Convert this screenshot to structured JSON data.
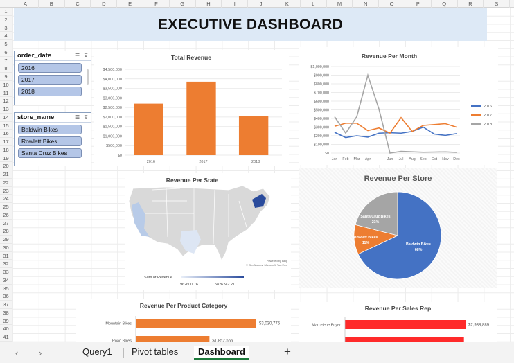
{
  "columns": [
    "A",
    "B",
    "C",
    "D",
    "E",
    "F",
    "G",
    "H",
    "I",
    "J",
    "K",
    "L",
    "M",
    "N",
    "O",
    "P",
    "Q",
    "R",
    "S"
  ],
  "rows": [
    "1",
    "2",
    "3",
    "4",
    "5",
    "6",
    "7",
    "8",
    "9",
    "10",
    "11",
    "12",
    "13",
    "14",
    "15",
    "16",
    "17",
    "18",
    "19",
    "20",
    "21",
    "22",
    "23",
    "24",
    "25",
    "26",
    "27",
    "28",
    "29",
    "30",
    "31",
    "32",
    "33",
    "34",
    "35",
    "36",
    "37",
    "38",
    "39",
    "40",
    "41"
  ],
  "dashboard_title": "EXECUTIVE DASHBOARD",
  "slicer_date": {
    "title": "order_date",
    "items": [
      "2016",
      "2017",
      "2018"
    ]
  },
  "slicer_store": {
    "title": "store_name",
    "items": [
      "Baldwin Bikes",
      "Rowlett Bikes",
      "Santa Cruz Bikes"
    ]
  },
  "map": {
    "title": "Revenue Per State",
    "legend_label": "Sum of Revenue",
    "min": "962600.76",
    "max": "5826242.21",
    "credit1": "Powered by Bing",
    "credit2": "© GeoNames, Microsoft, TomTom"
  },
  "chart_data": [
    {
      "type": "bar",
      "title": "Total Revenue",
      "categories": [
        "2016",
        "2017",
        "2018"
      ],
      "values": [
        2700000,
        3850000,
        2050000
      ],
      "yticks": [
        "$4,500,000",
        "$4,000,000",
        "$3,500,000",
        "$3,000,000",
        "$2,500,000",
        "$2,000,000",
        "$1,500,000",
        "$1,000,000",
        "$500,000",
        "$0"
      ],
      "ylim": [
        0,
        4500000
      ],
      "color": "#ed7d31"
    },
    {
      "type": "line",
      "title": "Revenue Per Month",
      "categories": [
        "Jan",
        "Feb",
        "Mar",
        "Apr",
        "Jun",
        "Jul",
        "Aug",
        "Sep",
        "Oct",
        "Nov",
        "Dec"
      ],
      "x_positions": [
        1,
        2,
        3,
        4,
        5,
        6,
        7,
        8,
        9,
        10,
        11,
        12
      ],
      "x_labels": [
        "Jan",
        "Feb",
        "Mar",
        "Apr",
        "Jun",
        "Jul",
        "Aug",
        "Sep",
        "Oct",
        "Nov",
        "Dec"
      ],
      "yticks": [
        "$1,000,000",
        "$900,000",
        "$800,000",
        "$700,000",
        "$600,000",
        "$500,000",
        "$400,000",
        "$300,000",
        "$200,000",
        "$100,000",
        "$0"
      ],
      "ylim": [
        0,
        1000000
      ],
      "series": [
        {
          "name": "2016",
          "color": "#4472c4",
          "values": [
            240000,
            180000,
            200000,
            185000,
            230000,
            235000,
            230000,
            250000,
            300000,
            220000,
            205000,
            225000
          ]
        },
        {
          "name": "2017",
          "color": "#ed7d31",
          "values": [
            310000,
            345000,
            345000,
            260000,
            290000,
            230000,
            410000,
            250000,
            320000,
            330000,
            340000,
            300000
          ]
        },
        {
          "name": "2018",
          "color": "#a5a5a5",
          "values": [
            420000,
            230000,
            420000,
            900000,
            510000,
            0,
            20000,
            15000,
            10000,
            12000,
            14000,
            8000
          ]
        }
      ]
    },
    {
      "type": "pie",
      "title": "Revenue Per Store",
      "categories": [
        "Baldwin Bikes",
        "Rowlett Bikes",
        "Santa Cruz Bikes"
      ],
      "values": [
        68,
        11,
        21
      ],
      "labels": [
        "68%",
        "11%",
        "21%"
      ],
      "colors": [
        "#4472c4",
        "#ed7d31",
        "#a5a5a5"
      ]
    },
    {
      "type": "bar",
      "orientation": "horizontal",
      "title": "Revenue Per Product Category",
      "categories": [
        "Mountain Bikes",
        "Road Bikes"
      ],
      "values": [
        3030776,
        1852556
      ],
      "labels": [
        "$3,030,776",
        "$1,852,556"
      ],
      "color": "#ed7d31"
    },
    {
      "type": "bar",
      "orientation": "horizontal",
      "title": "Revenue Per Sales Rep",
      "categories": [
        "Marcelene Boyer",
        ""
      ],
      "values": [
        2938889,
        2900000
      ],
      "labels": [
        "$2,938,889",
        ""
      ],
      "color": "#ff2a2a"
    }
  ],
  "tabs": {
    "query": "Query1",
    "pivot": "Pivot tables",
    "dashboard": "Dashboard",
    "add": "+"
  }
}
